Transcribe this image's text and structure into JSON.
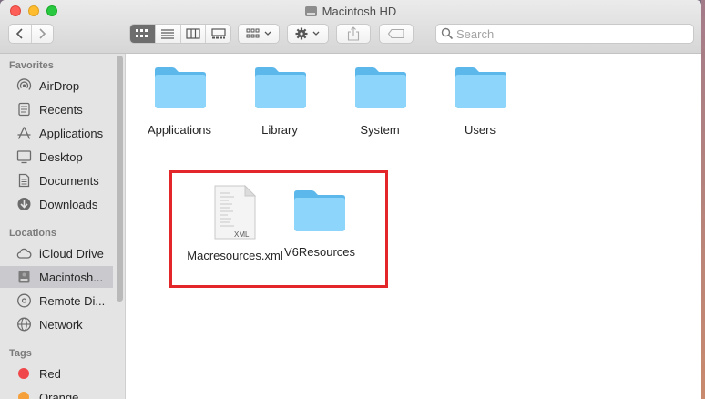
{
  "window": {
    "title": "Macintosh HD"
  },
  "toolbar": {
    "back": "back",
    "forward": "forward",
    "views": [
      "icon-view",
      "list-view",
      "column-view",
      "gallery-view"
    ],
    "search_placeholder": "Search"
  },
  "sidebar": {
    "favorites_label": "Favorites",
    "favorites": [
      {
        "label": "AirDrop",
        "icon": "airdrop-icon"
      },
      {
        "label": "Recents",
        "icon": "recents-icon"
      },
      {
        "label": "Applications",
        "icon": "applications-icon"
      },
      {
        "label": "Desktop",
        "icon": "desktop-icon"
      },
      {
        "label": "Documents",
        "icon": "documents-icon"
      },
      {
        "label": "Downloads",
        "icon": "downloads-icon"
      }
    ],
    "locations_label": "Locations",
    "locations": [
      {
        "label": "iCloud Drive",
        "icon": "cloud-icon"
      },
      {
        "label": "Macintosh...",
        "icon": "hard-drive-icon",
        "selected": true
      },
      {
        "label": "Remote Di...",
        "icon": "disc-icon"
      },
      {
        "label": "Network",
        "icon": "network-icon"
      }
    ],
    "tags_label": "Tags",
    "tags": [
      {
        "label": "Red",
        "color": "#f0484a"
      },
      {
        "label": "Orange",
        "color": "#f5a03a"
      }
    ]
  },
  "files": [
    {
      "name": "Applications",
      "kind": "folder"
    },
    {
      "name": "Library",
      "kind": "folder"
    },
    {
      "name": "System",
      "kind": "folder"
    },
    {
      "name": "Users",
      "kind": "folder"
    },
    {
      "name": "Macresources.xml",
      "kind": "xml-file",
      "badge": "XML"
    },
    {
      "name": "V6Resources",
      "kind": "folder"
    }
  ],
  "colors": {
    "folder": "#6cc4f3",
    "folder_light": "#8fd6fb",
    "highlight": "#e32629"
  }
}
